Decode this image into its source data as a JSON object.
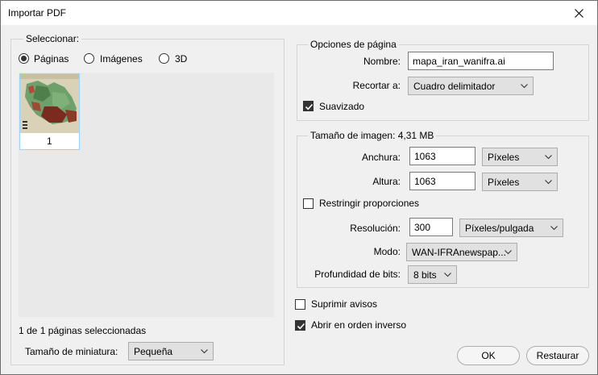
{
  "window": {
    "title": "Importar PDF"
  },
  "select_group": {
    "legend": "Seleccionar:",
    "options": [
      {
        "label": "Páginas",
        "checked": true
      },
      {
        "label": "Imágenes",
        "checked": false
      },
      {
        "label": "3D",
        "checked": false
      }
    ],
    "thumbnail_page_number": "1",
    "status": "1 de 1 páginas seleccionadas",
    "thumb_size_label": "Tamaño de miniatura:",
    "thumb_size_value": "Pequeña"
  },
  "page_options": {
    "legend": "Opciones de página",
    "name_label": "Nombre:",
    "name_value": "mapa_iran_wanifra.ai",
    "crop_label": "Recortar a:",
    "crop_value": "Cuadro delimitador",
    "smooth_label": "Suavizado",
    "smooth_checked": true
  },
  "image_size": {
    "legend": "Tamaño de imagen: 4,31 MB",
    "width_label": "Anchura:",
    "width_value": "1063",
    "width_unit": "Píxeles",
    "height_label": "Altura:",
    "height_value": "1063",
    "height_unit": "Píxeles",
    "constrain_label": "Restringir proporciones",
    "constrain_checked": false,
    "resolution_label": "Resolución:",
    "resolution_value": "300",
    "resolution_unit": "Píxeles/pulgada",
    "mode_label": "Modo:",
    "mode_value": "WAN-IFRAnewspap...",
    "depth_label": "Profundidad de bits:",
    "depth_value": "8 bits"
  },
  "footer": {
    "suppress_label": "Suprimir avisos",
    "suppress_checked": false,
    "reverse_label": "Abrir en orden inverso",
    "reverse_checked": true,
    "ok_label": "OK",
    "reset_label": "Restaurar"
  },
  "colors": {
    "accent_border": "#99d1ff",
    "button_primary_border": "#0078d7"
  },
  "icons": {
    "close": "close-icon",
    "chevron": "chevron-down-icon",
    "check": "check-icon"
  }
}
